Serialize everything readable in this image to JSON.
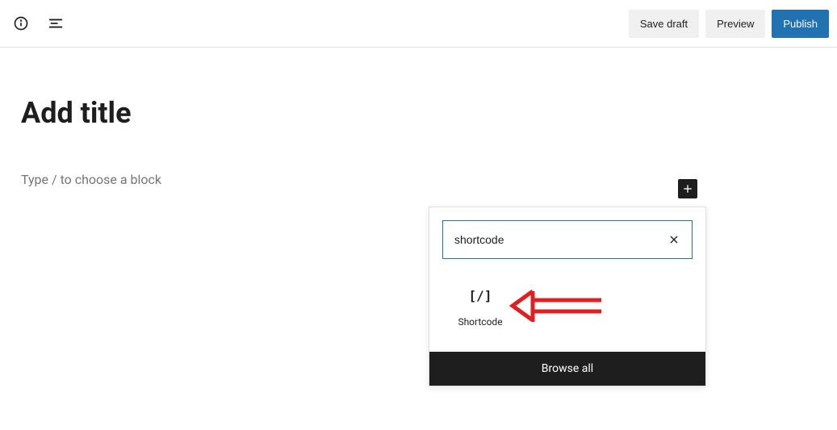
{
  "header": {
    "save_draft_label": "Save draft",
    "preview_label": "Preview",
    "publish_label": "Publish"
  },
  "editor": {
    "title_placeholder": "Add title",
    "body_placeholder": "Type / to choose a block"
  },
  "inserter": {
    "search_value": "shortcode",
    "results": [
      {
        "icon": "[/]",
        "label": "Shortcode"
      }
    ],
    "browse_all_label": "Browse all"
  }
}
